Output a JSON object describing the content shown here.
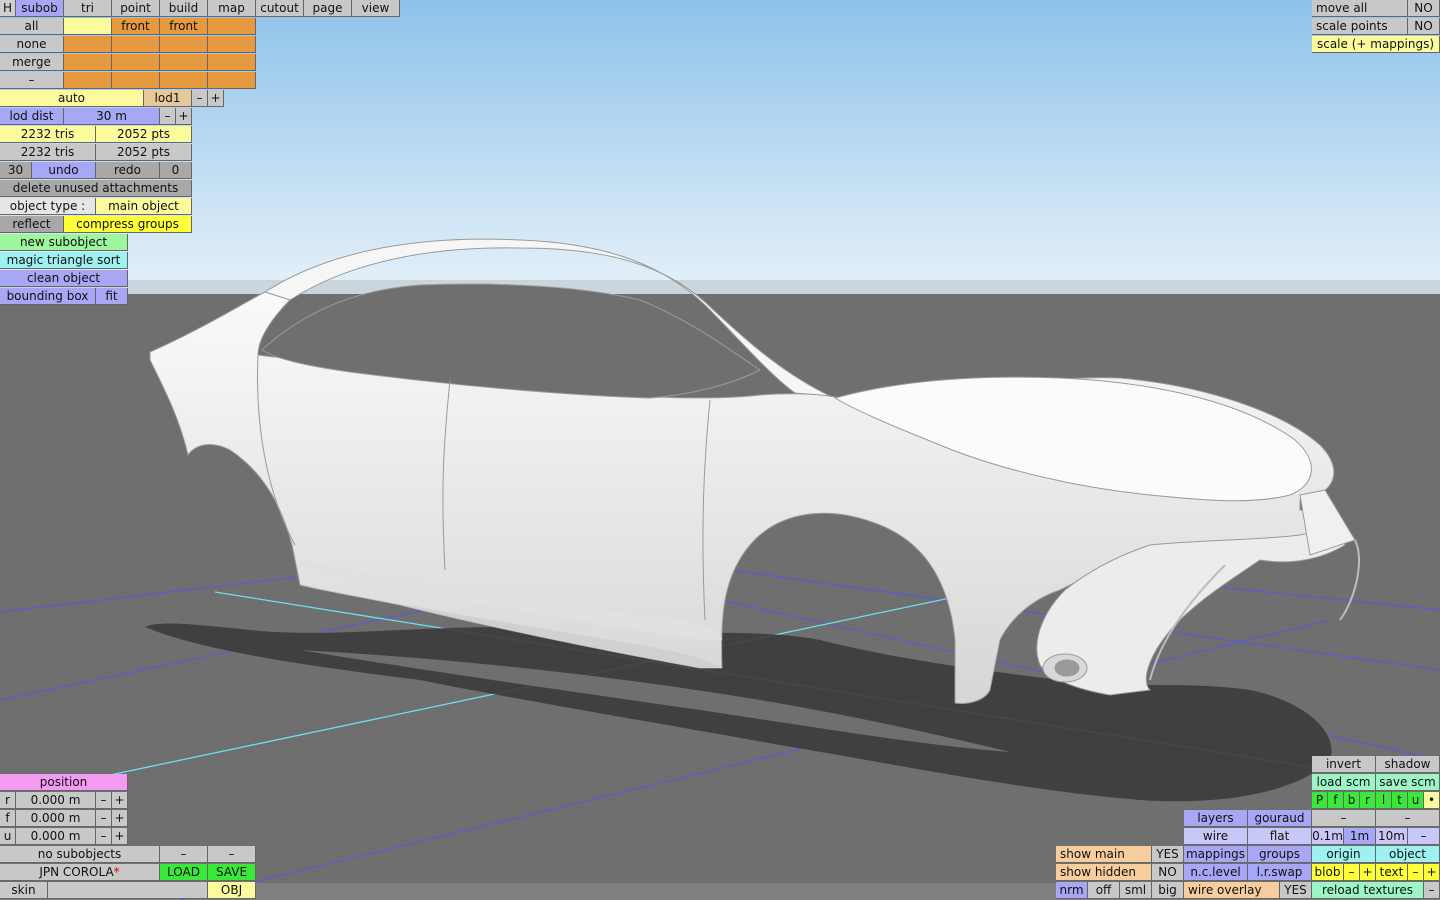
{
  "colors": {
    "sky_top": "#8ec2ea",
    "sky_bottom": "#dfeef8",
    "ground": "#6e6e6e",
    "car_body": "#eeeeee",
    "shadow": "#3a3a3a",
    "grid_blue": "#5a5ad8",
    "grid_cyan": "#6ae0f0"
  },
  "icons": {
    "car_model": "car-body-wireframe-icon"
  },
  "top_tabs": [
    "H",
    "subob",
    "tri",
    "point",
    "build",
    "map",
    "cutout",
    "page",
    "view"
  ],
  "subobj_panel": {
    "all": "all",
    "none": "none",
    "merge": "merge",
    "minus": "–",
    "front1": "front",
    "front2": "front"
  },
  "lod": {
    "auto": "auto",
    "lod1": "lod1",
    "minus": "–",
    "plus": "+",
    "lod_dist_label": "lod dist",
    "lod_dist_value": "30 m"
  },
  "stats": {
    "tris1": "2232 tris",
    "pts1": "2052 pts",
    "tris2": "2232 tris",
    "pts2": "2052 pts"
  },
  "history": {
    "undo_count": "30",
    "undo": "undo",
    "redo": "redo",
    "redo_count": "0"
  },
  "actions": {
    "delete_unused": "delete unused attachments",
    "object_type_label": "object type :",
    "object_type_value": "main object",
    "reflect": "reflect",
    "compress_groups": "compress groups",
    "new_subobject": "new subobject",
    "magic_sort": "magic triangle sort",
    "clean_object": "clean object",
    "bounding_box": "bounding box",
    "fit": "fit"
  },
  "top_right": {
    "move_all": "move all",
    "move_all_value": "NO",
    "scale_points": "scale points",
    "scale_points_value": "NO",
    "scale_mappings": "scale (+ mappings)"
  },
  "position": {
    "header": "position",
    "r_label": "r",
    "r_value": "0.000 m",
    "f_label": "f",
    "f_value": "0.000 m",
    "u_label": "u",
    "u_value": "0.000 m",
    "minus": "–",
    "plus": "+"
  },
  "bottom_left": {
    "no_subobjects": "no subobjects",
    "dash1": "–",
    "dash2": "–",
    "file_name": "JPN COROLA",
    "modified_mark": "*",
    "load": "LOAD",
    "save": "SAVE",
    "skin": "skin",
    "obj": "OBJ"
  },
  "bottom_right": {
    "invert": "invert",
    "shadow": "shadow",
    "load_scm": "load scm",
    "save_scm": "save scm",
    "view_letters": [
      "P",
      "f",
      "b",
      "r",
      "l",
      "t",
      "u",
      "•"
    ],
    "dash_a": "–",
    "dash_b": "–",
    "layers": "layers",
    "gouraud": "gouraud",
    "wire": "wire",
    "flat": "flat",
    "step1": "0.1m",
    "step2": "1m",
    "step3": "10m",
    "step_minus": "–",
    "show_main": "show main",
    "show_main_value": "YES",
    "mappings": "mappings",
    "groups": "groups",
    "origin": "origin",
    "object": "object",
    "show_hidden": "show hidden",
    "show_hidden_value": "NO",
    "nc_level": "n.c.level",
    "lr_swap": "l.r.swap",
    "blob": "blob",
    "blob_minus": "–",
    "blob_plus": "+",
    "text": "text",
    "text_minus": "–",
    "text_plus": "+",
    "nrm": "nrm",
    "off": "off",
    "sml": "sml",
    "big": "big",
    "wire_overlay": "wire overlay",
    "wire_overlay_value": "YES",
    "reload_textures": "reload textures",
    "reload_minus": "–"
  }
}
